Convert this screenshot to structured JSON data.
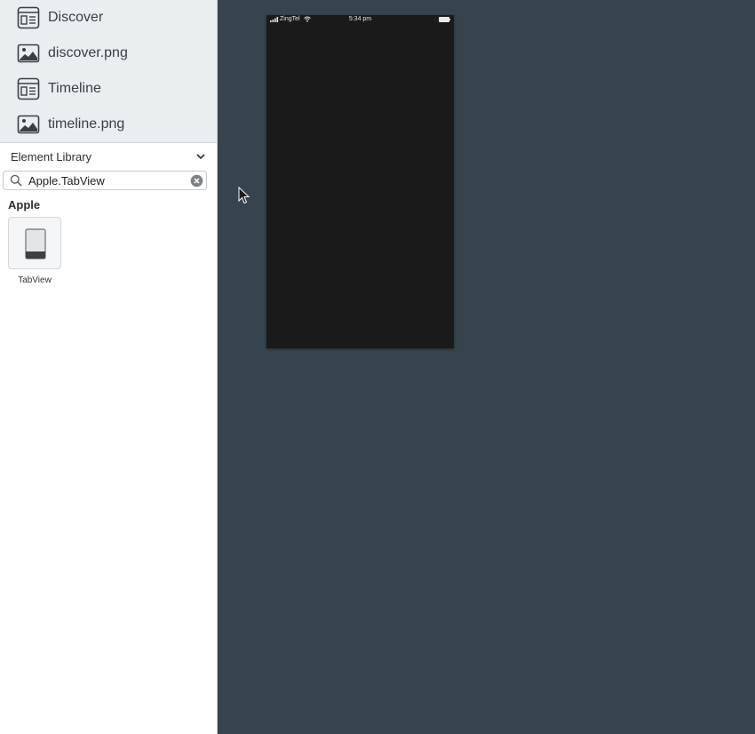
{
  "file_list": [
    {
      "label": "Discover",
      "icon": "layout-icon"
    },
    {
      "label": "discover.png",
      "icon": "image-icon"
    },
    {
      "label": "Timeline",
      "icon": "layout-icon"
    },
    {
      "label": "timeline.png",
      "icon": "image-icon"
    }
  ],
  "library": {
    "title": "Element Library",
    "search_value": "Apple.TabView",
    "group_title": "Apple",
    "item_label": "TabView"
  },
  "phone": {
    "carrier": "ZingTel",
    "time": "5:34 pm"
  },
  "colors": {
    "canvas_bg": "#37444d",
    "file_list_bg": "#e9eef0",
    "phone_bg": "#1a1a1a"
  }
}
